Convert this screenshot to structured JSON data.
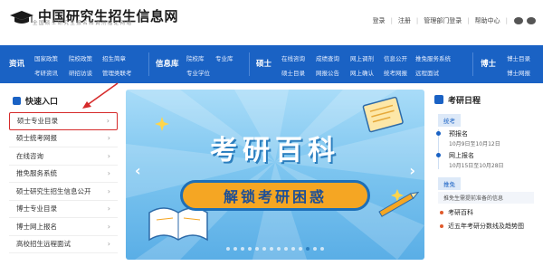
{
  "header": {
    "logo_title": "中国研究生招生信息网",
    "logo_sub": "全国硕士研究生报名和调剂指定网站",
    "links": [
      "登录",
      "注册",
      "管理部门登录",
      "帮助中心"
    ]
  },
  "nav": {
    "zixun": {
      "label": "资讯",
      "links": [
        "国家政策",
        "院校政策",
        "招生简章",
        "考研资讯",
        "研招访谈",
        "管理类联考"
      ]
    },
    "xinxiku": {
      "label": "信息库",
      "links": [
        "院校库",
        "专业库",
        "专业学位"
      ]
    },
    "shuoshi": {
      "label": "硕士",
      "links": [
        "在线咨询",
        "成绩查询",
        "网上调剂",
        "信息公开",
        "推免服务系统",
        "硕士目录",
        "网报公告",
        "网上确认",
        "统考网报",
        "远程面试"
      ]
    },
    "boshi": {
      "label": "博士",
      "links": [
        "博士目录",
        "博士网报"
      ]
    }
  },
  "quick_entry": {
    "title": "快速入口",
    "items": [
      "硕士专业目录",
      "硕士统考网报",
      "在线咨询",
      "推免服务系统",
      "硕士研究生招生信息公开",
      "博士专业目录",
      "博士网上报名",
      "高校招生远程面试"
    ]
  },
  "banner": {
    "title": "考研百科",
    "pill": "解锁考研困惑",
    "slide_count": 14,
    "active_slide": 11
  },
  "calendar": {
    "title": "考研日程",
    "tag1": "统考",
    "events": [
      {
        "name": "预报名",
        "date": "10月9日至10月12日"
      },
      {
        "name": "网上报名",
        "date": "10月15日至10月28日"
      }
    ],
    "tag2": "推免",
    "faded_text": "推免生需提前准备的信息",
    "links": [
      "考研百科",
      "近五年考研分数线及趋势图"
    ]
  },
  "colors": {
    "nav_blue": "#1a62c4",
    "highlight_red": "#d62b2b"
  }
}
